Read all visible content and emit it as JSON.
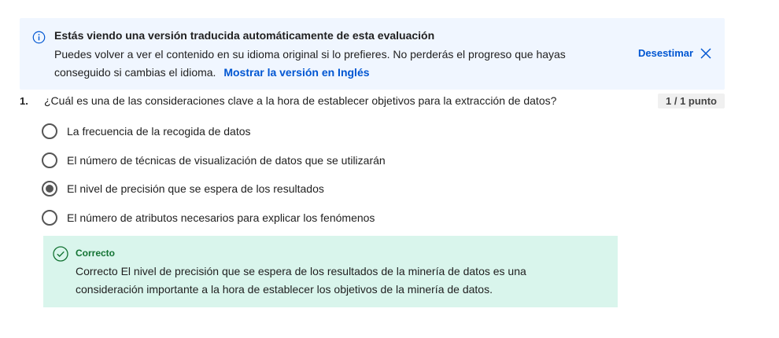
{
  "banner": {
    "title": "Estás viendo una versión traducida automáticamente de esta evaluación",
    "body": "Puedes volver a ver el contenido en su idioma original si lo prefieres. No perderás el progreso que hayas conseguido si cambias el idioma.",
    "show_link": "Mostrar la versión en Inglés",
    "dismiss_label": "Desestimar",
    "icon": "info-icon",
    "accent_color": "#0056d2",
    "background": "#f0f6ff"
  },
  "question": {
    "number": "1.",
    "text": "¿Cuál es una de las consideraciones clave a la hora de establecer objetivos para la extracción de datos?",
    "score": "1 / 1 punto",
    "options": [
      {
        "label": "La frecuencia de la recogida de datos",
        "selected": false
      },
      {
        "label": "El número de técnicas de visualización de datos que se utilizarán",
        "selected": false
      },
      {
        "label": "El nivel de precisión que se espera de los resultados",
        "selected": true
      },
      {
        "label": "El número de atributos necesarios para explicar los fenómenos",
        "selected": false
      }
    ]
  },
  "feedback": {
    "title": "Correcto",
    "body": "Correcto El nivel de precisión que se espera de los resultados de la minería de datos es una consideración importante a la hora de establecer los objetivos de la minería de datos.",
    "icon": "check-circle-icon",
    "color": "#137333",
    "background": "#d9f5ec"
  }
}
